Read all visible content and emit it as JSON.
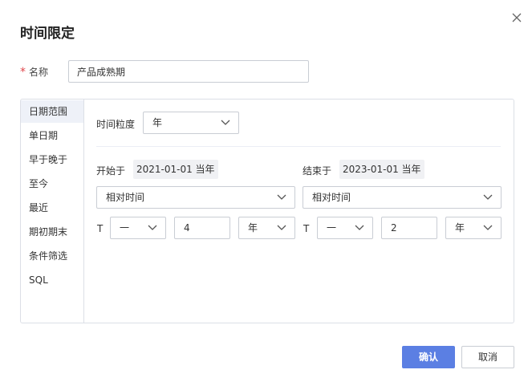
{
  "dialog": {
    "title": "时间限定"
  },
  "name_field": {
    "required_mark": "*",
    "label": "名称",
    "value": "产品成熟期"
  },
  "tabs": [
    "日期范围",
    "单日期",
    "早于晚于",
    "至今",
    "最近",
    "期初期末",
    "条件筛选",
    "SQL"
  ],
  "active_tab": "日期范围",
  "granularity": {
    "label": "时间粒度",
    "value": "年"
  },
  "start": {
    "label": "开始于",
    "value": "2021-01-01 当年",
    "mode": "相对时间",
    "t_label": "T",
    "sign": "一",
    "offset": "4",
    "unit": "年"
  },
  "end": {
    "label": "结束于",
    "value": "2023-01-01 当年",
    "mode": "相对时间",
    "t_label": "T",
    "sign": "一",
    "offset": "2",
    "unit": "年"
  },
  "buttons": {
    "confirm": "确认",
    "cancel": "取消"
  },
  "colors": {
    "primary": "#5b7fe3",
    "required": "#e0474c",
    "active_tab_bg": "#eef1f8"
  }
}
